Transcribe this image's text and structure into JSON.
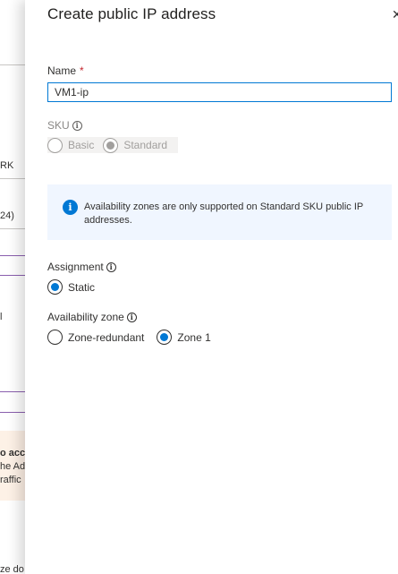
{
  "background_blade": {
    "fragments": {
      "text1": "RK",
      "text2": "24)",
      "text3": "l",
      "warning_line1": "o acc",
      "warning_line2": "he Ad",
      "warning_line3": "raffic",
      "bottom_text": "ze do"
    },
    "colors": {
      "divider": "#c8c6c4",
      "accent_line": "#8a5fae",
      "warning_bg": "#fdf1e6"
    }
  },
  "panel": {
    "title": "Create public IP address",
    "close_icon": "close-icon",
    "name": {
      "label": "Name",
      "required_mark": "*",
      "value": "VM1-ip"
    },
    "sku": {
      "label": "SKU",
      "info_icon": "info-icon",
      "options": [
        {
          "label": "Basic",
          "checked": false,
          "disabled": true
        },
        {
          "label": "Standard",
          "checked": true,
          "disabled": true
        }
      ]
    },
    "info_banner": {
      "icon": "info-icon",
      "text": "Availability zones are only supported on Standard SKU public IP addresses."
    },
    "assignment": {
      "label": "Assignment",
      "info_icon": "info-icon",
      "options": [
        {
          "label": "Static",
          "checked": true
        }
      ]
    },
    "availability_zone": {
      "label": "Availability zone",
      "info_icon": "info-icon",
      "options": [
        {
          "label": "Zone-redundant",
          "checked": false
        },
        {
          "label": "Zone 1",
          "checked": true
        }
      ]
    }
  },
  "colors": {
    "accent": "#0078d4",
    "required": "#c4262e",
    "banner_bg": "#f0f6ff"
  }
}
